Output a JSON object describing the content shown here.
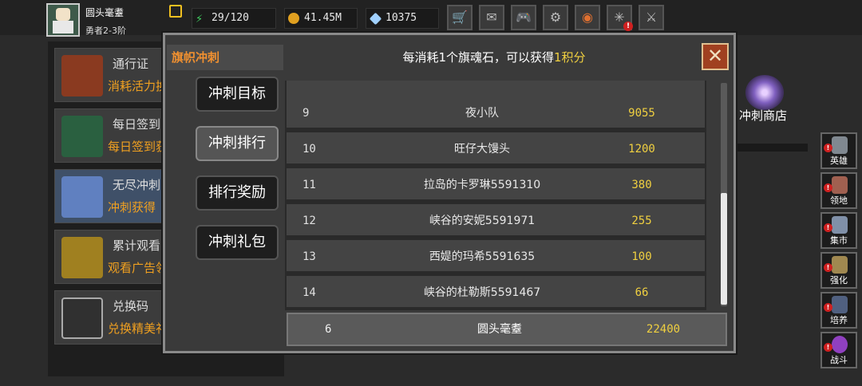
{
  "player": {
    "name": "圆头毫耋",
    "rank": "勇者2-3阶"
  },
  "resources": {
    "energy": "29/120",
    "gold": "41.45M",
    "gems": "10375"
  },
  "top_buttons": [
    "cart-icon",
    "mail-icon",
    "gamepad-icon",
    "gear-icon",
    "color-wheel-icon",
    "broken-icon",
    "sword-crossed-icon"
  ],
  "left_list": [
    {
      "title": "通行证",
      "subtitle": "消耗活力换",
      "icon": "trophy-cup-icon"
    },
    {
      "title": "每日签到",
      "subtitle": "每日签到获",
      "icon": "book-stack-icon"
    },
    {
      "title": "无尽冲刺",
      "subtitle": "冲刺获得",
      "icon": "crystal-statue-icon"
    },
    {
      "title": "累计观看",
      "subtitle": "观看广告领",
      "icon": "treasure-chest-icon"
    },
    {
      "title": "兑换码",
      "subtitle": "兑换精美礼",
      "icon": "key-icon"
    }
  ],
  "right_panel": {
    "shop_label": "冲刺商店"
  },
  "side_buttons": [
    {
      "label": "英雄",
      "alert": true
    },
    {
      "label": "领地",
      "alert": true
    },
    {
      "label": "集市",
      "alert": true
    },
    {
      "label": "强化",
      "alert": true
    },
    {
      "label": "培养",
      "alert": true
    },
    {
      "label": "战斗",
      "alert": true
    }
  ],
  "modal": {
    "tab_title": "旗帜冲刺",
    "header_pre": "每消耗1个旗魂石，可以获得",
    "header_value": "1积分",
    "nav": [
      {
        "label": "冲刺目标",
        "active": false
      },
      {
        "label": "冲刺排行",
        "active": true
      },
      {
        "label": "排行奖励",
        "active": false
      },
      {
        "label": "冲刺礼包",
        "active": false
      }
    ],
    "ranking": [
      {
        "rank": "9",
        "name": "夜小队",
        "score": "9055"
      },
      {
        "rank": "10",
        "name": "旺仔大馒头",
        "score": "1200"
      },
      {
        "rank": "11",
        "name": "拉岛的卡罗琳5591310",
        "score": "380"
      },
      {
        "rank": "12",
        "name": "峡谷的安妮5591971",
        "score": "255"
      },
      {
        "rank": "13",
        "name": "西媞的玛希5591635",
        "score": "100"
      },
      {
        "rank": "14",
        "name": "峡谷的杜勒斯5591467",
        "score": "66"
      }
    ],
    "my_entry": {
      "rank": "6",
      "name": "圆头毫耋",
      "score": "22400"
    }
  }
}
